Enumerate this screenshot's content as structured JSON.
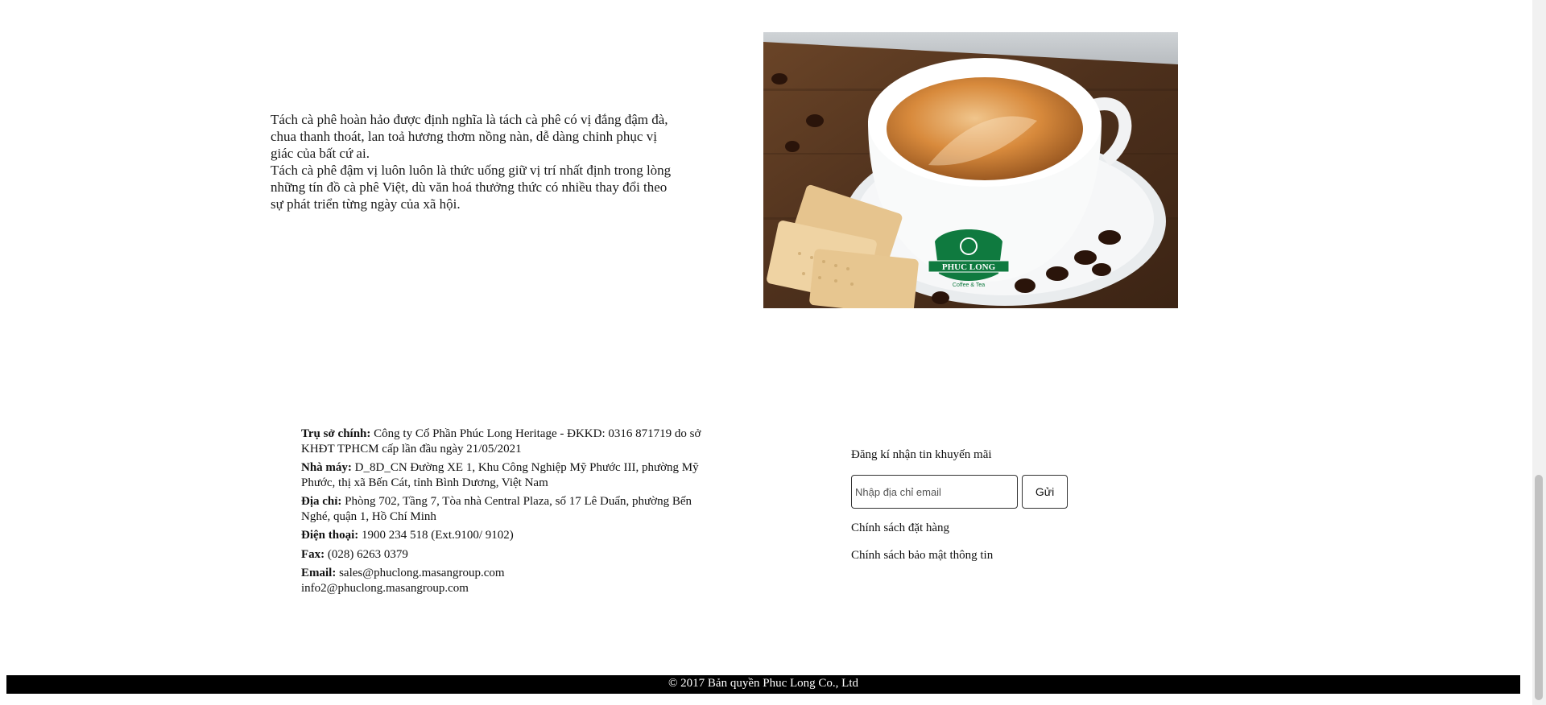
{
  "intro": {
    "paragraph_1": "Tách cà phê hoàn hảo được định nghĩa là tách cà phê có vị đắng đậm đà, chua thanh thoát, lan toả hương thơm nồng nàn, dễ dàng chinh phục vị giác của bất cứ ai.",
    "paragraph_2": "Tách cà phê đậm vị luôn luôn là thức uống giữ vị trí nhất định trong lòng những tín đồ cà phê Việt, dù văn hoá thưởng thức có nhiều thay đổi theo sự phát triển từng ngày của xã hội."
  },
  "photo": {
    "logo_text": "PHUC LONG",
    "logo_tagline": "Coffee & Tea"
  },
  "contact": {
    "head_office_label": "Trụ sở chính:",
    "head_office_value": "Công ty Cổ Phần Phúc Long Heritage - ĐKKD: 0316 871719 do sở KHĐT TPHCM cấp lần đầu ngày 21/05/2021",
    "factory_label": "Nhà máy:",
    "factory_value": "D_8D_CN Đường XE 1, Khu Công Nghiệp Mỹ Phước III, phường Mỹ Phước, thị xã Bến Cát, tỉnh Bình Dương, Việt Nam",
    "address_label": "Địa chỉ:",
    "address_value": "Phòng 702, Tầng 7, Tòa nhà Central Plaza, số 17 Lê Duẩn, phường Bến Nghé, quận 1, Hồ Chí Minh",
    "phone_label": "Điện thoại:",
    "phone_value": "1900 234 518 (Ext.9100/ 9102)",
    "fax_label": "Fax:",
    "fax_value": "(028) 6263 0379",
    "email_label": "Email:",
    "email_value_1": "sales@phuclong.masangroup.com",
    "email_value_2": "info2@phuclong.masangroup.com"
  },
  "newsletter": {
    "title": "Đăng kí nhận tin khuyến mãi",
    "input_placeholder": "Nhập địa chỉ email",
    "input_value": "",
    "send_label": "Gửi",
    "policy_order": "Chính sách đặt hàng",
    "policy_privacy": "Chính sách bảo mật thông tin"
  },
  "footer": {
    "copyright": "© 2017 Bản quyền Phuc Long Co., Ltd"
  },
  "colors": {
    "footer_bg": "#000000",
    "logo_green": "#0f7a3f",
    "coffee": "#c9782f",
    "table_wood": "#5a3a22"
  }
}
